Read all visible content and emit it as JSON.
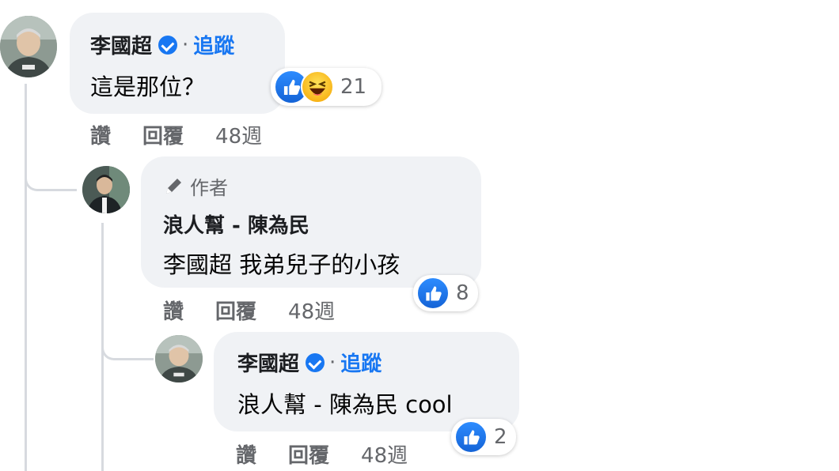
{
  "comments": [
    {
      "name": "李國超",
      "dot": "·",
      "follow": "追蹤",
      "text": "這是那位？",
      "reaction_count": "21",
      "reactions": [
        "like-icon",
        "haha-icon"
      ],
      "actions": {
        "like": "讚",
        "reply": "回覆",
        "time": "48週"
      }
    },
    {
      "author_label": "作者",
      "name": "浪人幫 - 陳為民",
      "text": "李國超 我弟兒子的小孩",
      "reaction_count": "8",
      "reactions": [
        "like-icon"
      ],
      "actions": {
        "like": "讚",
        "reply": "回覆",
        "time": "48週"
      }
    },
    {
      "name": "李國超",
      "dot": "·",
      "follow": "追蹤",
      "text": "浪人幫 - 陳為民 cool",
      "reaction_count": "2",
      "reactions": [
        "like-icon"
      ],
      "actions": {
        "like": "讚",
        "reply": "回覆",
        "time": "48週"
      }
    }
  ],
  "colors": {
    "bubble": "#f0f2f5",
    "accent": "#1877f2",
    "secondary_text": "#65676b",
    "thread_line": "#d7dadf"
  }
}
